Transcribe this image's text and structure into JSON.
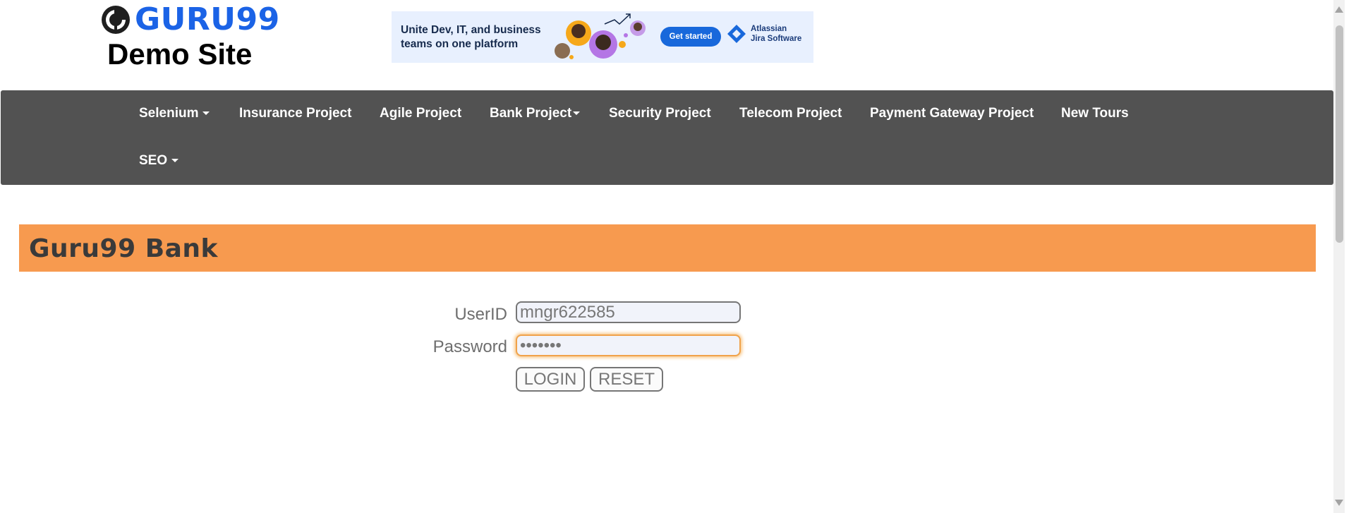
{
  "header": {
    "logo_text": "GURU99",
    "site_title": "Demo Site"
  },
  "ad": {
    "line1": "Unite Dev, IT, and business",
    "line2": "teams on one platform",
    "cta": "Get started",
    "brand_line1": "Atlassian",
    "brand_line2": "Jira Software"
  },
  "nav": {
    "items": [
      {
        "label": "Selenium",
        "dropdown": true
      },
      {
        "label": "Insurance Project",
        "dropdown": false
      },
      {
        "label": "Agile Project",
        "dropdown": false
      },
      {
        "label": "Bank Project",
        "dropdown": true
      },
      {
        "label": "Security Project",
        "dropdown": false
      },
      {
        "label": "Telecom Project",
        "dropdown": false
      },
      {
        "label": "Payment Gateway Project",
        "dropdown": false
      },
      {
        "label": "New Tours",
        "dropdown": false
      },
      {
        "label": "SEO",
        "dropdown": true
      }
    ]
  },
  "page": {
    "title": "Guru99 Bank"
  },
  "form": {
    "userid_label": "UserID",
    "userid_value": "mngr622585",
    "password_label": "Password",
    "password_value": "•••••••",
    "login_label": "LOGIN",
    "reset_label": "RESET"
  },
  "colors": {
    "nav_bg": "#525252",
    "title_bar": "#f79a4f",
    "logo_blue": "#1b63e6",
    "focus_outline": "#f0a24a"
  }
}
